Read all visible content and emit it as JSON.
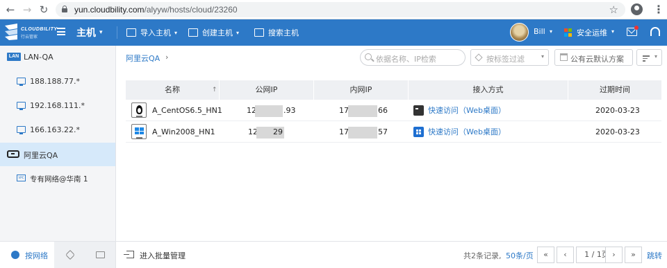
{
  "browser": {
    "url_host": "yun.cloudbility.com",
    "url_path": "/alyyw/hosts/cloud/23260"
  },
  "header": {
    "logo_text": "CLOUDBILITY",
    "logo_sub": "行云管家",
    "module": "主机",
    "menus": [
      {
        "label": "导入主机"
      },
      {
        "label": "创建主机"
      },
      {
        "label": "搜索主机"
      }
    ],
    "user": "Bill",
    "ops_label": "安全运维",
    "brand_color": "#2d79c7"
  },
  "sidebar": {
    "items": [
      {
        "label": "LAN-QA",
        "icon": "lan-badge-icon",
        "badge": "LAN"
      },
      {
        "label": "188.188.77.*",
        "icon": "monitor-icon"
      },
      {
        "label": "192.168.111.*",
        "icon": "monitor-icon"
      },
      {
        "label": "166.163.22.*",
        "icon": "monitor-icon"
      },
      {
        "label": "阿里云QA",
        "icon": "aliyun-icon",
        "active": true
      },
      {
        "label": "专有网络@华南 1",
        "icon": "vpc-icon"
      }
    ],
    "tabs": [
      {
        "label": "按网络",
        "icon": "network-icon",
        "active": true
      },
      {
        "label": "",
        "icon": "tag-icon"
      },
      {
        "label": "",
        "icon": "folder-icon"
      }
    ]
  },
  "toolbar": {
    "breadcrumb": "阿里云QA",
    "search_placeholder": "依据名称、IP检索",
    "tag_filter_placeholder": "按标签过滤",
    "scheme_value": "公有云默认方案"
  },
  "table": {
    "headers": [
      "名称",
      "公网IP",
      "内网IP",
      "接入方式",
      "过期时间"
    ],
    "rows": [
      {
        "name": "A_CentOS6.5_HN1",
        "os": "linux",
        "public_ip_prefix": "12",
        "public_ip_suffix": ".93",
        "private_ip_prefix": "17",
        "private_ip_suffix": "66",
        "access": "快速访问（Web桌面）",
        "expire": "2020-03-23"
      },
      {
        "name": "A_Win2008_HN1",
        "os": "windows",
        "public_ip_prefix": "12",
        "public_ip_suffix": "29",
        "private_ip_prefix": "17",
        "private_ip_suffix": "57",
        "access": "快速访问（Web桌面）",
        "expire": "2020-03-23"
      }
    ]
  },
  "footer": {
    "batch_label": "进入批量管理",
    "total": "共2条记录,",
    "per_page": "50条/页",
    "page": "1 / 1页",
    "first": "«",
    "prev": "‹",
    "next": "›",
    "last": "»",
    "jump": "跳转"
  }
}
